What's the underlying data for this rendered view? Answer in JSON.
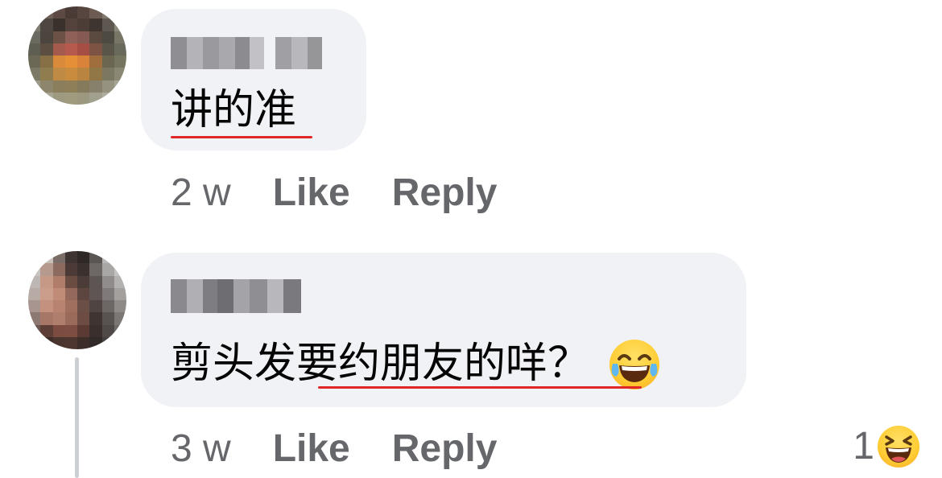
{
  "comments": [
    {
      "text": "讲的准",
      "time": "2 w",
      "like_label": "Like",
      "reply_label": "Reply"
    },
    {
      "text": "剪头发要约朋友的咩？",
      "emoji": "tears-of-joy-emoji",
      "time": "3 w",
      "like_label": "Like",
      "reply_label": "Reply",
      "reaction_count": "1",
      "reaction_icon": "laughing-emoji"
    }
  ],
  "colors": {
    "bubble": "#f0f2f5",
    "meta_text": "#65676b",
    "underline": "#e02727"
  }
}
